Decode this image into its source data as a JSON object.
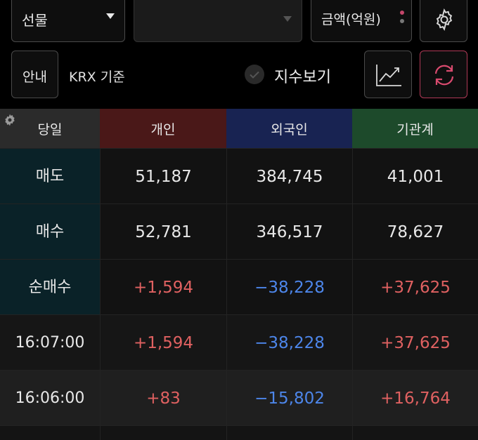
{
  "controls": {
    "market_select": "선물",
    "amount_unit": "금액(억원)",
    "guide_label": "안내",
    "basis_label": "KRX 기준",
    "index_toggle_label": "지수보기"
  },
  "colors": {
    "personal_header": "#4a1818",
    "foreign_header": "#182352",
    "institution_header": "#1d4a2b",
    "positive": "#e06161",
    "negative": "#4d86ea",
    "summary_label_bg": "#0a2228",
    "refresh_accent": "#b03a57"
  },
  "icons": [
    "chevron-down-icon",
    "more-dots-icon",
    "gear-icon",
    "check-circle-icon",
    "line-chart-icon",
    "refresh-icon",
    "settings-small-icon"
  ],
  "table": {
    "headers": [
      "당일",
      "개인",
      "외국인",
      "기관계"
    ],
    "rows": [
      {
        "label": "매도",
        "values": [
          "51,187",
          "384,745",
          "41,001"
        ]
      },
      {
        "label": "매수",
        "values": [
          "52,781",
          "346,517",
          "78,627"
        ]
      },
      {
        "label": "순매수",
        "values": [
          "+1,594",
          "−38,228",
          "+37,625"
        ]
      },
      {
        "label": "16:07:00",
        "values": [
          "+1,594",
          "−38,228",
          "+37,625"
        ]
      },
      {
        "label": "16:06:00",
        "values": [
          "+83",
          "−15,802",
          "+16,764"
        ]
      }
    ]
  }
}
